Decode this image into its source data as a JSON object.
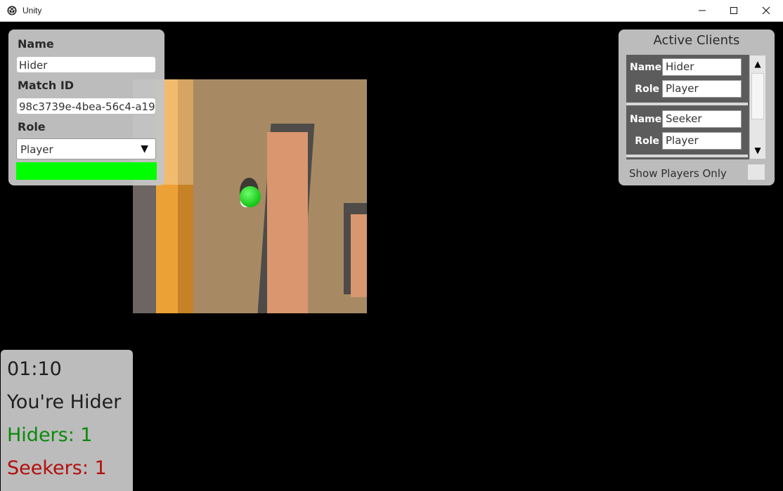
{
  "window": {
    "title": "Unity"
  },
  "player_panel": {
    "name_label": "Name",
    "name_value": "Hider",
    "match_id_label": "Match ID",
    "match_id_value": "98c3739e-4bea-56c4-a19",
    "role_label": "Role",
    "role_value": "Player",
    "status_color": "#00ff00"
  },
  "clients_panel": {
    "title": "Active Clients",
    "clients": [
      {
        "name_label": "Name",
        "name": "Hider",
        "role_label": "Role",
        "role": "Player"
      },
      {
        "name_label": "Name",
        "name": "Seeker",
        "role_label": "Role",
        "role": "Player"
      }
    ],
    "show_players_only_label": "Show Players Only",
    "show_players_only_checked": false
  },
  "stats_panel": {
    "timer": "01:10",
    "role_text": "You're Hider",
    "hiders_text": "Hiders: 1",
    "seekers_text": "Seekers: 1",
    "hiders_color": "#0a8a0a",
    "seekers_color": "#b30d0d"
  },
  "icons": {
    "scroll_up": "▲",
    "scroll_down": "▼",
    "dropdown": "▼"
  }
}
